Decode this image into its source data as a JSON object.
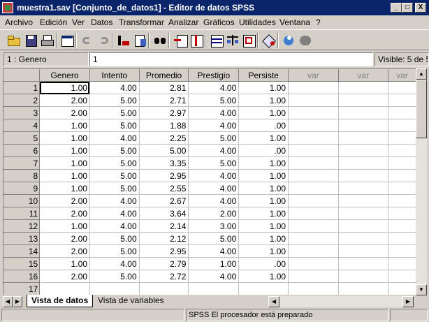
{
  "window": {
    "title": "muestra1.sav [Conjunto_de_datos1] - Editor de datos SPSS",
    "minimize": "_",
    "maximize": "□",
    "close": "X"
  },
  "menu": [
    "Archivo",
    "Edición",
    "Ver",
    "Datos",
    "Transformar",
    "Analizar",
    "Gráficos",
    "Utilidades",
    "Ventana",
    "?"
  ],
  "toolbar_icons": [
    "open-icon",
    "save-icon",
    "print-icon",
    "dialog-recall-icon",
    "undo-icon",
    "redo-icon",
    "goto-case-icon",
    "variables-icon",
    "find-icon",
    "insert-cases-icon",
    "insert-variable-icon",
    "split-file-icon",
    "weight-cases-icon",
    "select-cases-icon",
    "value-labels-icon",
    "use-sets-icon",
    "show-all-variables-icon"
  ],
  "cellbar": {
    "reference": "1 : Genero",
    "value": "1",
    "visible": "Visible: 5 de 5"
  },
  "grid": {
    "columns": [
      "Genero",
      "Intento",
      "Promedio",
      "Prestigio",
      "Persiste",
      "var",
      "var",
      "var"
    ],
    "rows": [
      {
        "n": "1",
        "cells": [
          "1.00",
          "4.00",
          "2.81",
          "4.00",
          "1.00"
        ]
      },
      {
        "n": "2",
        "cells": [
          "2.00",
          "5.00",
          "2.71",
          "5.00",
          "1.00"
        ]
      },
      {
        "n": "3",
        "cells": [
          "2.00",
          "5.00",
          "2.97",
          "4.00",
          "1.00"
        ]
      },
      {
        "n": "4",
        "cells": [
          "1.00",
          "5.00",
          "1.88",
          "4.00",
          ".00"
        ]
      },
      {
        "n": "5",
        "cells": [
          "1.00",
          "4.00",
          "2.25",
          "5.00",
          "1.00"
        ]
      },
      {
        "n": "6",
        "cells": [
          "1.00",
          "5.00",
          "5.00",
          "4.00",
          ".00"
        ]
      },
      {
        "n": "7",
        "cells": [
          "1.00",
          "5.00",
          "3.35",
          "5.00",
          "1.00"
        ]
      },
      {
        "n": "8",
        "cells": [
          "1.00",
          "5.00",
          "2.95",
          "4.00",
          "1.00"
        ]
      },
      {
        "n": "9",
        "cells": [
          "1.00",
          "5.00",
          "2.55",
          "4.00",
          "1.00"
        ]
      },
      {
        "n": "10",
        "cells": [
          "2.00",
          "4.00",
          "2.67",
          "4.00",
          "1.00"
        ]
      },
      {
        "n": "11",
        "cells": [
          "2.00",
          "4.00",
          "3.64",
          "2.00",
          "1.00"
        ]
      },
      {
        "n": "12",
        "cells": [
          "1.00",
          "4.00",
          "2.14",
          "3.00",
          "1.00"
        ]
      },
      {
        "n": "13",
        "cells": [
          "2.00",
          "5.00",
          "2.12",
          "5.00",
          "1.00"
        ]
      },
      {
        "n": "14",
        "cells": [
          "2.00",
          "5.00",
          "2.95",
          "4.00",
          "1.00"
        ]
      },
      {
        "n": "15",
        "cells": [
          "1.00",
          "4.00",
          "2.79",
          "1.00",
          ".00"
        ]
      },
      {
        "n": "16",
        "cells": [
          "2.00",
          "5.00",
          "2.72",
          "4.00",
          "1.00"
        ]
      },
      {
        "n": "17",
        "cells": [
          "",
          "",
          "",
          "",
          ""
        ]
      }
    ]
  },
  "tabs": {
    "data_view": "Vista de datos",
    "variable_view": "Vista de variables"
  },
  "status": "SPSS El procesador  está preparado"
}
